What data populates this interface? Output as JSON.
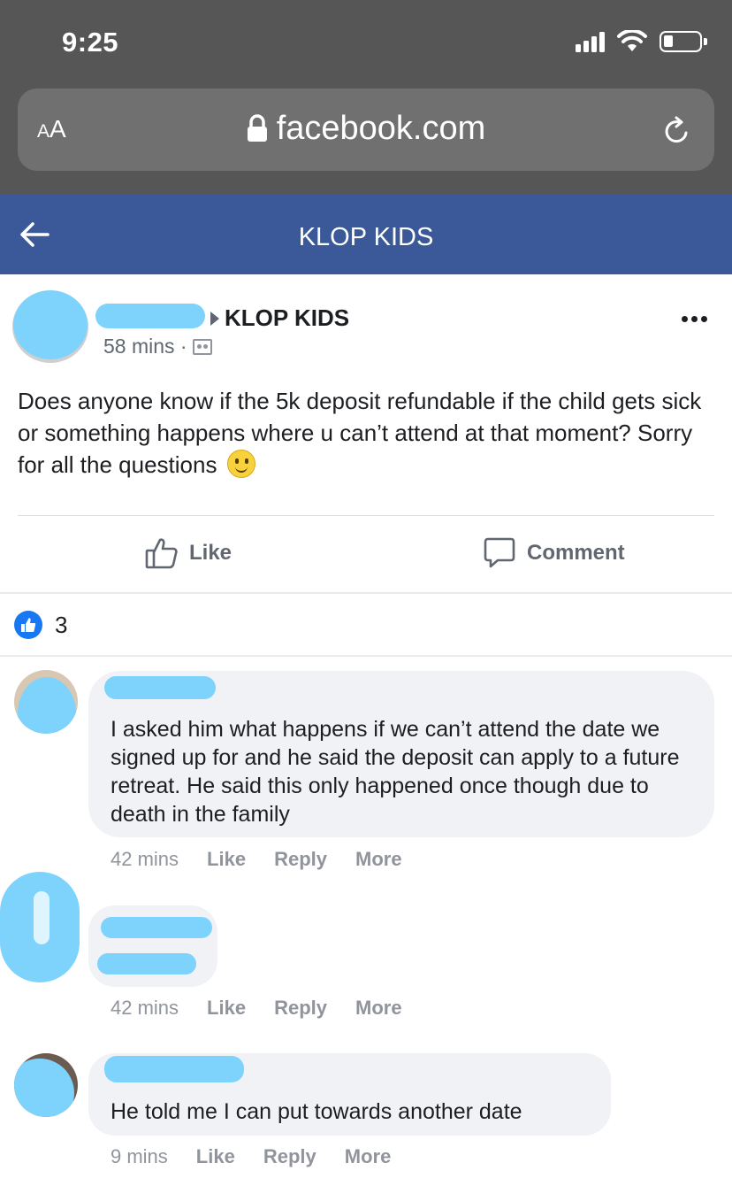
{
  "status_bar": {
    "time": "9:25"
  },
  "browser": {
    "aa_small": "A",
    "aa_large": "A",
    "url": "facebook.com"
  },
  "header": {
    "title": "KLOP KIDS"
  },
  "post": {
    "group_name": "KLOP KIDS",
    "time": "58 mins ·",
    "text": "Does anyone know if the 5k deposit refundable if the child gets sick or something happens where u can’t attend at that moment? Sorry for all the questions",
    "like_label": "Like",
    "comment_label": "Comment",
    "reaction_count": "3"
  },
  "comments": [
    {
      "text": "I asked him what happens if we can’t attend the date we signed up for and he said the deposit can apply to a future retreat. He said this only happened once though due to death in the family",
      "time": "42 mins",
      "like": "Like",
      "reply": "Reply",
      "more": "More"
    },
    {
      "text": "",
      "time": "42 mins",
      "like": "Like",
      "reply": "Reply",
      "more": "More"
    },
    {
      "text": "He told me I can put towards another date",
      "time": "9 mins",
      "like": "Like",
      "reply": "Reply",
      "more": "More"
    }
  ],
  "colors": {
    "facebook_blue": "#3b5998",
    "redaction": "#7dd3fc",
    "bubble": "#f0f2f5"
  },
  "icons": [
    "signal-icon",
    "wifi-icon",
    "battery-icon",
    "lock-icon",
    "reload-icon",
    "back-arrow-icon",
    "more-icon",
    "group-icon",
    "thumbs-up-icon",
    "comment-icon",
    "like-reaction-icon",
    "smiley-emoji-icon"
  ]
}
